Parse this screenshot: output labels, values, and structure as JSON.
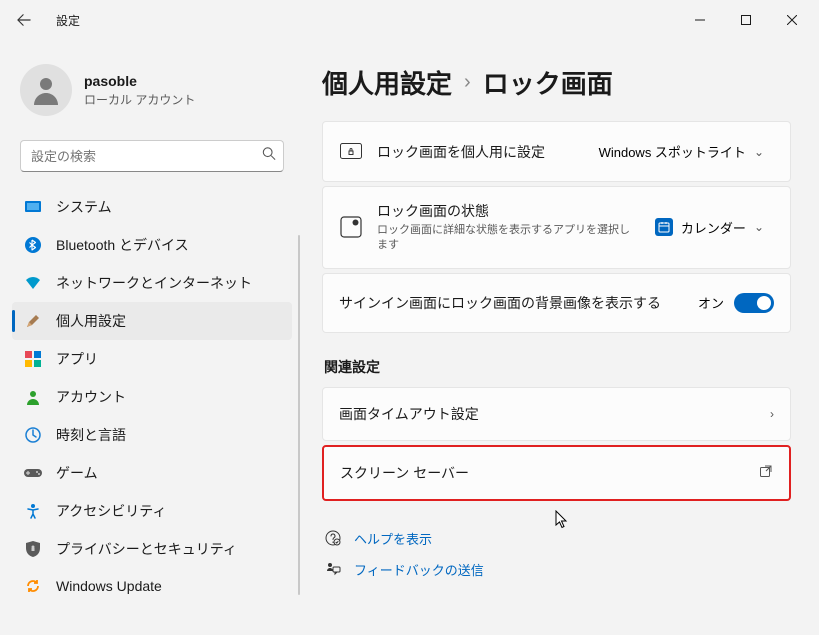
{
  "app_title": "設定",
  "user": {
    "name": "pasoble",
    "sub": "ローカル アカウント"
  },
  "search": {
    "placeholder": "設定の検索"
  },
  "nav": {
    "items": [
      {
        "label": "システム"
      },
      {
        "label": "Bluetooth とデバイス"
      },
      {
        "label": "ネットワークとインターネット"
      },
      {
        "label": "個人用設定"
      },
      {
        "label": "アプリ"
      },
      {
        "label": "アカウント"
      },
      {
        "label": "時刻と言語"
      },
      {
        "label": "ゲーム"
      },
      {
        "label": "アクセシビリティ"
      },
      {
        "label": "プライバシーとセキュリティ"
      },
      {
        "label": "Windows Update"
      }
    ]
  },
  "breadcrumb": {
    "parent": "個人用設定",
    "current": "ロック画面"
  },
  "main": {
    "personalize": {
      "title": "ロック画面を個人用に設定",
      "value": "Windows スポットライト"
    },
    "status": {
      "title": "ロック画面の状態",
      "sub": "ロック画面に詳細な状態を表示するアプリを選択します",
      "value": "カレンダー"
    },
    "showbg": {
      "title": "サインイン画面にロック画面の背景画像を表示する",
      "toggle_label": "オン"
    }
  },
  "related": {
    "header": "関連設定",
    "timeout": "画面タイムアウト設定",
    "screensaver": "スクリーン セーバー"
  },
  "help": {
    "show": "ヘルプを表示",
    "feedback": "フィードバックの送信"
  }
}
